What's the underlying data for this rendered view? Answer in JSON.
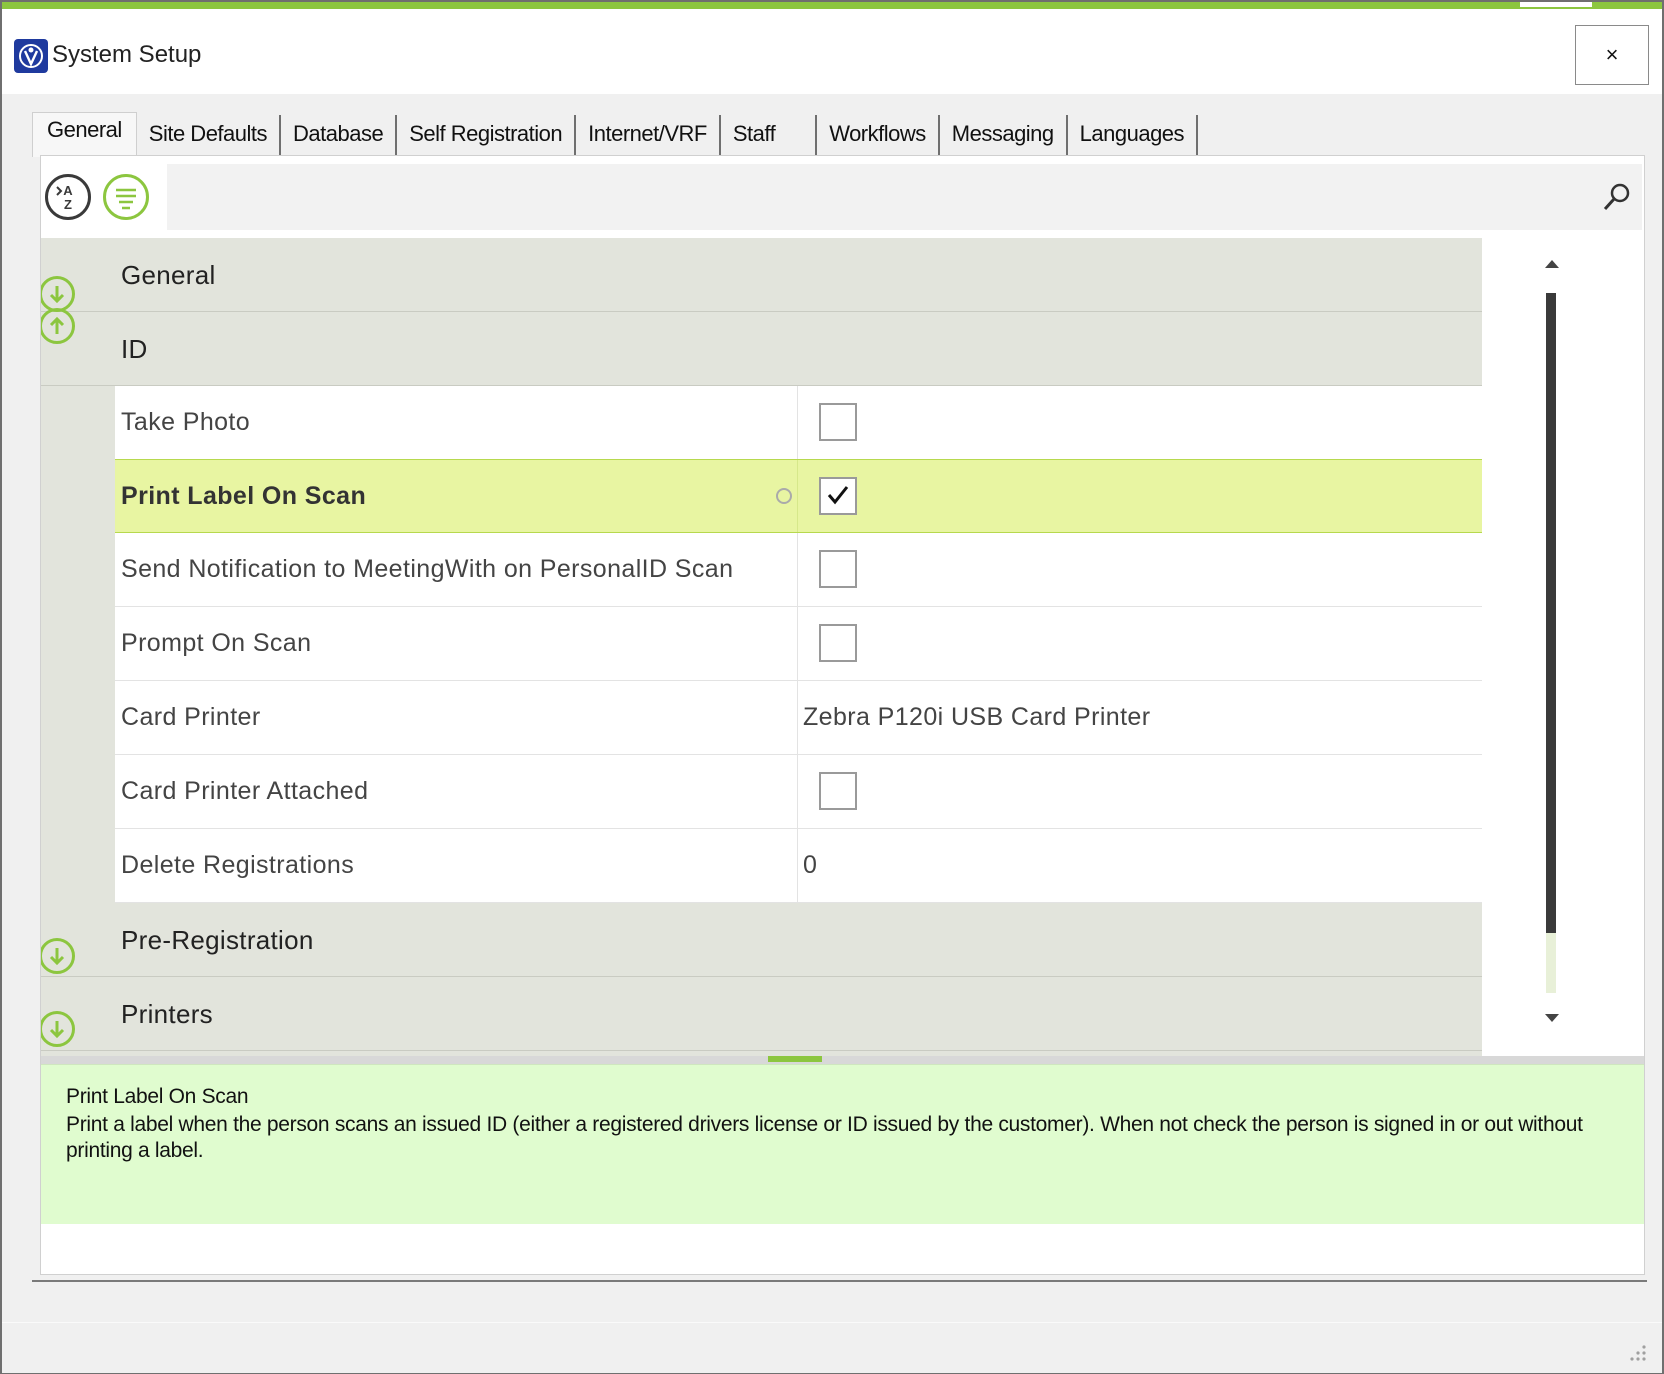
{
  "window": {
    "title": "System Setup",
    "close_label": "×"
  },
  "tabs": [
    {
      "label": "General",
      "active": true
    },
    {
      "label": "Site Defaults"
    },
    {
      "label": "Database"
    },
    {
      "label": "Self Registration"
    },
    {
      "label": "Internet/VRF"
    },
    {
      "label": "Staff"
    },
    {
      "label": "Workflows"
    },
    {
      "label": "Messaging"
    },
    {
      "label": "Languages"
    }
  ],
  "toolbar": {
    "sort_alpha_icon": "sort-az-icon",
    "categorized_icon": "categorized-list-icon",
    "search_placeholder": "",
    "search_icon": "magnifier-icon"
  },
  "grid": {
    "categories": {
      "general": "General",
      "id": "ID",
      "pre_registration": "Pre-Registration",
      "printers": "Printers"
    },
    "properties": [
      {
        "name": "Take Photo",
        "type": "checkbox",
        "checked": false
      },
      {
        "name": "Print Label On Scan",
        "type": "checkbox",
        "checked": true,
        "selected": true
      },
      {
        "name": "Send Notification to MeetingWith on PersonalID Scan",
        "type": "checkbox",
        "checked": false
      },
      {
        "name": "Prompt On Scan",
        "type": "checkbox",
        "checked": false
      },
      {
        "name": "Card Printer",
        "type": "text",
        "value": "Zebra P120i USB Card Printer"
      },
      {
        "name": "Card Printer Attached",
        "type": "checkbox",
        "checked": false
      },
      {
        "name": "Delete Registrations",
        "type": "text",
        "value": "0"
      }
    ]
  },
  "help": {
    "title": "Print Label On Scan",
    "description": "Print a label when the person scans an issued ID (either a registered drivers license or ID issued by the customer). When not check the person is signed in or out without printing a label."
  },
  "colors": {
    "accent": "#8cc63f",
    "selected_row": "#e8f5a2",
    "help_background": "#e0fccf",
    "category_background": "#e2e4dc"
  }
}
